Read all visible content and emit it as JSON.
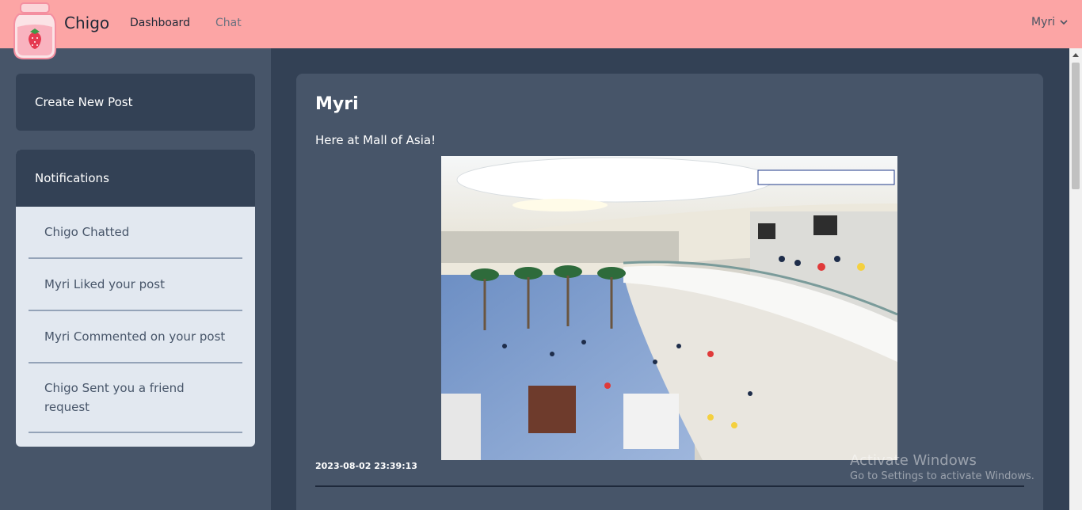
{
  "navbar": {
    "brand": "Chigo",
    "links": [
      "Dashboard",
      "Chat"
    ],
    "user": "Myri",
    "user_icon": "chevron-down-icon",
    "logo_icon": "strawberry-milk-jar-logo"
  },
  "sidebar": {
    "create_post_label": "Create New Post",
    "notifications_title": "Notifications",
    "notifications": [
      "Chigo Chatted",
      "Myri Liked your post",
      "Myri Commented on your post",
      "Chigo Sent you a friend request"
    ]
  },
  "post": {
    "author": "Myri",
    "body": "Here at Mall of Asia!",
    "timestamp": "2023-08-02 23:39:13"
  },
  "watermark": {
    "title": "Activate Windows",
    "subtitle": "Go to Settings to activate Windows."
  },
  "colors": {
    "navbar": "#fca5a5",
    "sidebar": "#475569",
    "card_dark": "#334155",
    "notif_bg": "#e2e8f0"
  }
}
